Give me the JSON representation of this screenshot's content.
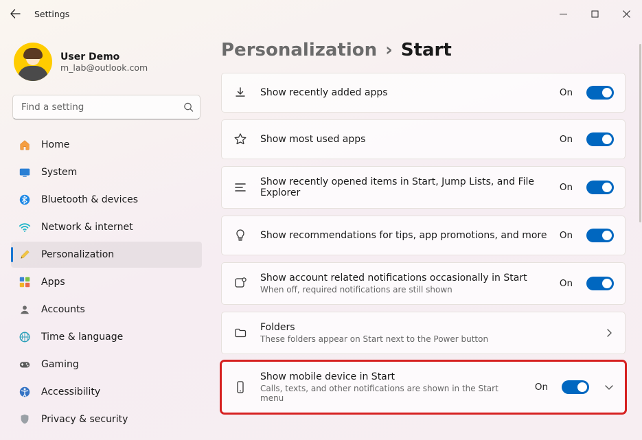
{
  "window": {
    "title": "Settings"
  },
  "user": {
    "name": "User Demo",
    "email": "m_lab@outlook.com"
  },
  "search": {
    "placeholder": "Find a setting"
  },
  "sidebar": {
    "items": [
      {
        "label": "Home"
      },
      {
        "label": "System"
      },
      {
        "label": "Bluetooth & devices"
      },
      {
        "label": "Network & internet"
      },
      {
        "label": "Personalization"
      },
      {
        "label": "Apps"
      },
      {
        "label": "Accounts"
      },
      {
        "label": "Time & language"
      },
      {
        "label": "Gaming"
      },
      {
        "label": "Accessibility"
      },
      {
        "label": "Privacy & security"
      }
    ],
    "active_index": 4
  },
  "breadcrumb": {
    "parent": "Personalization",
    "sep": "›",
    "current": "Start"
  },
  "settings": [
    {
      "title": "Show recently added apps",
      "sub": "",
      "state": "On",
      "trailing": "toggle"
    },
    {
      "title": "Show most used apps",
      "sub": "",
      "state": "On",
      "trailing": "toggle"
    },
    {
      "title": "Show recently opened items in Start, Jump Lists, and File Explorer",
      "sub": "",
      "state": "On",
      "trailing": "toggle"
    },
    {
      "title": "Show recommendations for tips, app promotions, and more",
      "sub": "",
      "state": "On",
      "trailing": "toggle"
    },
    {
      "title": "Show account related notifications occasionally in Start",
      "sub": "When off, required notifications are still shown",
      "state": "On",
      "trailing": "toggle"
    },
    {
      "title": "Folders",
      "sub": "These folders appear on Start next to the Power button",
      "state": "",
      "trailing": "chevron"
    },
    {
      "title": "Show mobile device in Start",
      "sub": "Calls, texts, and other notifications are shown in the Start menu",
      "state": "On",
      "trailing": "toggle-expand",
      "highlight": true
    }
  ]
}
